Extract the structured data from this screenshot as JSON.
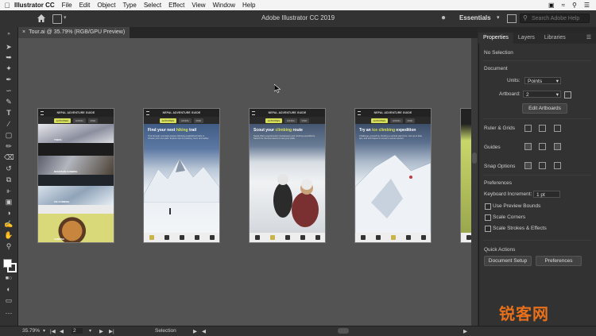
{
  "menubar": {
    "app_name": "Illustrator CC",
    "items": [
      "File",
      "Edit",
      "Object",
      "Type",
      "Select",
      "Effect",
      "View",
      "Window",
      "Help"
    ]
  },
  "appbar": {
    "title": "Adobe Illustrator CC 2019",
    "workspace": "Essentials",
    "search_placeholder": "Search Adobe Help"
  },
  "document_tab": {
    "label": "Tour.ai @ 35.79% (RGB/GPU Preview)",
    "close": "×"
  },
  "artboards": [
    {
      "header": "NEPAL ADVENTURE GUIDE",
      "nav": [
        "ACTIVITIES",
        "HIKING",
        "FIND"
      ],
      "stripes": [
        "TREKS",
        "MOUNTAIN CLIMBING",
        "ICE CLIMBING",
        "CAMPING"
      ]
    },
    {
      "header": "NEPAL ADVENTURE GUIDE",
      "nav": [
        "ACTIVITIES",
        "HIKING",
        "FIND"
      ],
      "title_pre": "Find your next ",
      "title_hl": "hiking",
      "title_post": " trail",
      "body": "Trek through mountain passes following established trails or choose your own path. Explore tips for packing, food, and safety."
    },
    {
      "header": "NEPAL ADVENTURE GUIDE",
      "nav": [
        "ACTIVITIES",
        "HIKING",
        "FIND"
      ],
      "title_pre": "Scout your ",
      "title_hl": "climbing",
      "title_post": " route",
      "body": "Nepal offers experienced mountaineers and climbing expeditions. Search for the best ascent to test your skills."
    },
    {
      "header": "NEPAL ADVENTURE GUIDE",
      "nav": [
        "ACTIVITIES",
        "HIKING",
        "FIND"
      ],
      "title_pre": "Try an ",
      "title_hl": "ice climbing",
      "title_post": " expedition",
      "body": "Challenge yourself by climbing a vertical wall of ice. Get up to date tips, and techniques to ensure a secure ascent."
    }
  ],
  "panel": {
    "tabs": [
      "Properties",
      "Layers",
      "Libraries"
    ],
    "no_selection": "No Selection",
    "document_heading": "Document",
    "units_label": "Units:",
    "units_value": "Points",
    "artboard_label": "Artboard:",
    "artboard_value": "2",
    "edit_artboards": "Edit Artboards",
    "ruler_grids": "Ruler & Grids",
    "guides": "Guides",
    "snap_options": "Snap Options",
    "preferences_heading": "Preferences",
    "keyboard_increment_label": "Keyboard Increment:",
    "keyboard_increment_value": "1 pt",
    "use_preview_bounds": "Use Preview Bounds",
    "scale_corners": "Scale Corners",
    "scale_strokes": "Scale Strokes & Effects",
    "quick_actions": "Quick Actions",
    "document_setup": "Document Setup",
    "preferences_button": "Preferences"
  },
  "status": {
    "zoom": "35.79%",
    "artboard_num": "2",
    "tool": "Selection"
  },
  "watermark": "锐客网",
  "colors": {
    "accent": "#d8e05a",
    "canvas": "#535353",
    "panel": "#323232"
  }
}
